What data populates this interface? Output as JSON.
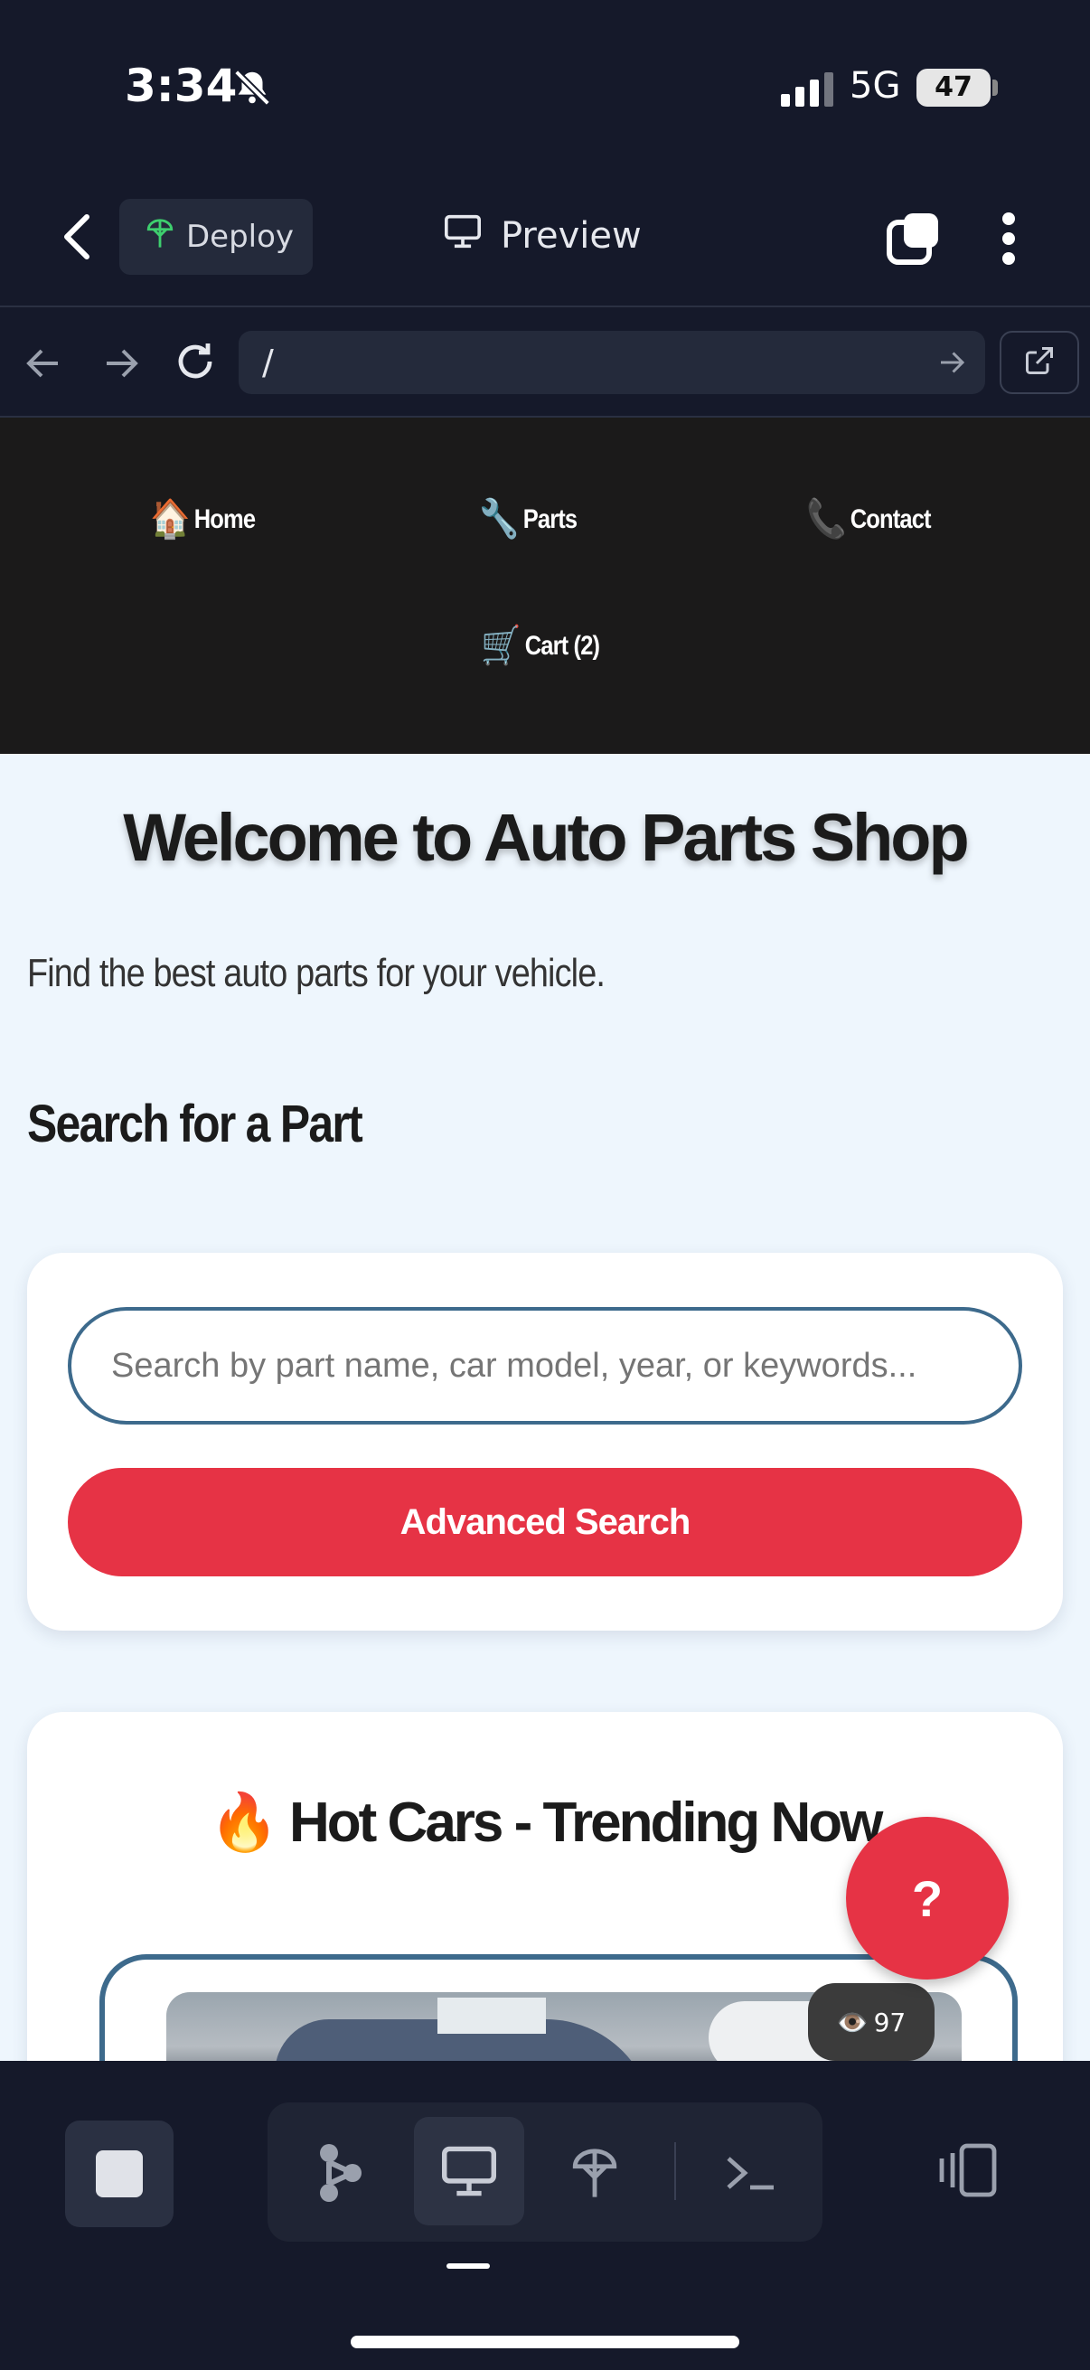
{
  "status": {
    "time": "3:34",
    "network": "5G",
    "battery": "47"
  },
  "toolbar": {
    "deploy_label": "Deploy",
    "preview_label": "Preview"
  },
  "url_bar": {
    "path": "/"
  },
  "site": {
    "nav": [
      {
        "emoji": "🏠",
        "label": "Home"
      },
      {
        "emoji": "🔧",
        "label": "Parts"
      },
      {
        "emoji": "📞",
        "label": "Contact"
      },
      {
        "emoji": "🛒",
        "label": "Cart (2)"
      }
    ],
    "title": "Welcome to Auto Parts Shop",
    "tagline": "Find the best auto parts for your vehicle.",
    "search_heading": "Search for a Part",
    "search": {
      "placeholder": "Search by part name, car model, year, or keywords...",
      "button": "Advanced Search"
    },
    "hot": {
      "emoji": "🔥",
      "title": "Hot Cars - Trending Now",
      "view_emoji": "👁️",
      "views": "97"
    },
    "help_label": "?"
  },
  "colors": {
    "accent": "#e63345",
    "border_blue": "#3d6a8c",
    "nav_bg": "#1b1a1a",
    "app_bg": "#15192a"
  }
}
